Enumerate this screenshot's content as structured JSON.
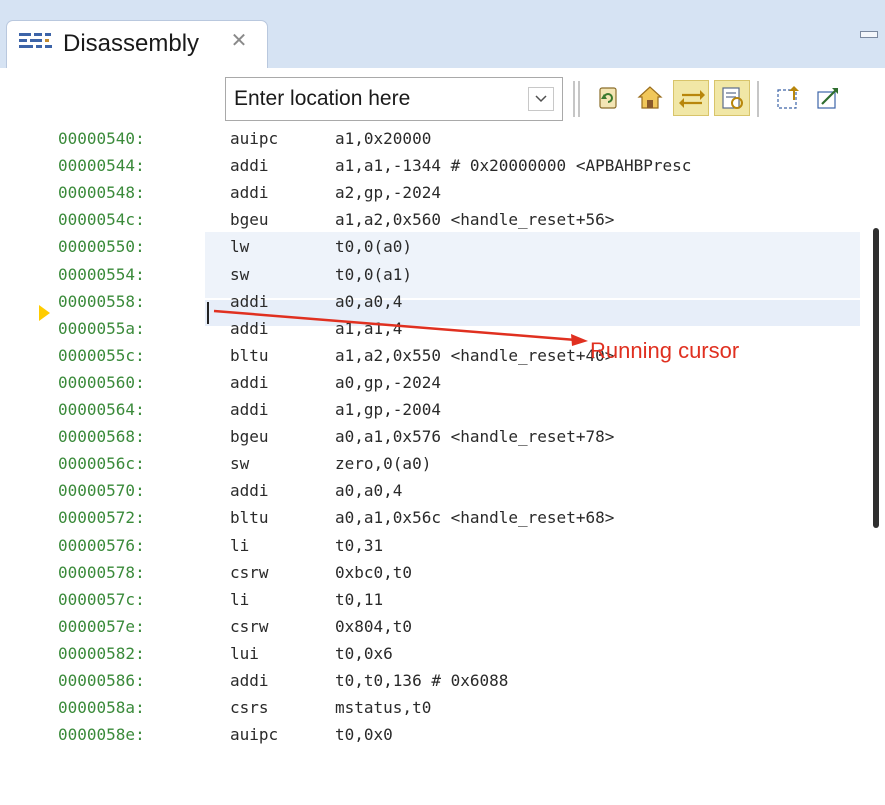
{
  "view": {
    "tab_title": "Disassembly",
    "tab_close_glyph": "✕",
    "tab_icon": "disassembly-icon",
    "location": {
      "placeholder": "Enter location here",
      "value": ""
    }
  },
  "toolbar_icons": [
    "refresh-icon",
    "home-icon",
    "link-with-active-debug-context-icon",
    "link-with-editor-icon",
    "export-icon",
    "open-editor-icon"
  ],
  "current_address": "00000558:",
  "annotation": {
    "label": "Running cursor",
    "color": "#e03020"
  },
  "colors": {
    "address": "#3a8a3a",
    "header_bg": "#d6e3f3",
    "current_line": "#e7eef9",
    "pc_marker": "#ffcc00"
  },
  "listing": [
    {
      "address": "00000540:",
      "mnemonic": "auipc",
      "operands": "a1,0x20000"
    },
    {
      "address": "00000544:",
      "mnemonic": "addi",
      "operands": "a1,a1,-1344 # 0x20000000 <APBAHBPresc"
    },
    {
      "address": "00000548:",
      "mnemonic": "addi",
      "operands": "a2,gp,-2024"
    },
    {
      "address": "0000054c:",
      "mnemonic": "bgeu",
      "operands": "a1,a2,0x560 <handle_reset+56>"
    },
    {
      "address": "00000550:",
      "mnemonic": "lw",
      "operands": "t0,0(a0)"
    },
    {
      "address": "00000554:",
      "mnemonic": "sw",
      "operands": "t0,0(a1)"
    },
    {
      "address": "00000558:",
      "mnemonic": "addi",
      "operands": "a0,a0,4"
    },
    {
      "address": "0000055a:",
      "mnemonic": "addi",
      "operands": "a1,a1,4"
    },
    {
      "address": "0000055c:",
      "mnemonic": "bltu",
      "operands": "a1,a2,0x550 <handle_reset+40>"
    },
    {
      "address": "00000560:",
      "mnemonic": "addi",
      "operands": "a0,gp,-2024"
    },
    {
      "address": "00000564:",
      "mnemonic": "addi",
      "operands": "a1,gp,-2004"
    },
    {
      "address": "00000568:",
      "mnemonic": "bgeu",
      "operands": "a0,a1,0x576 <handle_reset+78>"
    },
    {
      "address": "0000056c:",
      "mnemonic": "sw",
      "operands": "zero,0(a0)"
    },
    {
      "address": "00000570:",
      "mnemonic": "addi",
      "operands": "a0,a0,4"
    },
    {
      "address": "00000572:",
      "mnemonic": "bltu",
      "operands": "a0,a1,0x56c <handle_reset+68>"
    },
    {
      "address": "00000576:",
      "mnemonic": "li",
      "operands": "t0,31"
    },
    {
      "address": "00000578:",
      "mnemonic": "csrw",
      "operands": "0xbc0,t0"
    },
    {
      "address": "0000057c:",
      "mnemonic": "li",
      "operands": "t0,11"
    },
    {
      "address": "0000057e:",
      "mnemonic": "csrw",
      "operands": "0x804,t0"
    },
    {
      "address": "00000582:",
      "mnemonic": "lui",
      "operands": "t0,0x6"
    },
    {
      "address": "00000586:",
      "mnemonic": "addi",
      "operands": "t0,t0,136 # 0x6088"
    },
    {
      "address": "0000058a:",
      "mnemonic": "csrs",
      "operands": "mstatus,t0"
    },
    {
      "address": "0000058e:",
      "mnemonic": "auipc",
      "operands": "t0,0x0"
    }
  ]
}
